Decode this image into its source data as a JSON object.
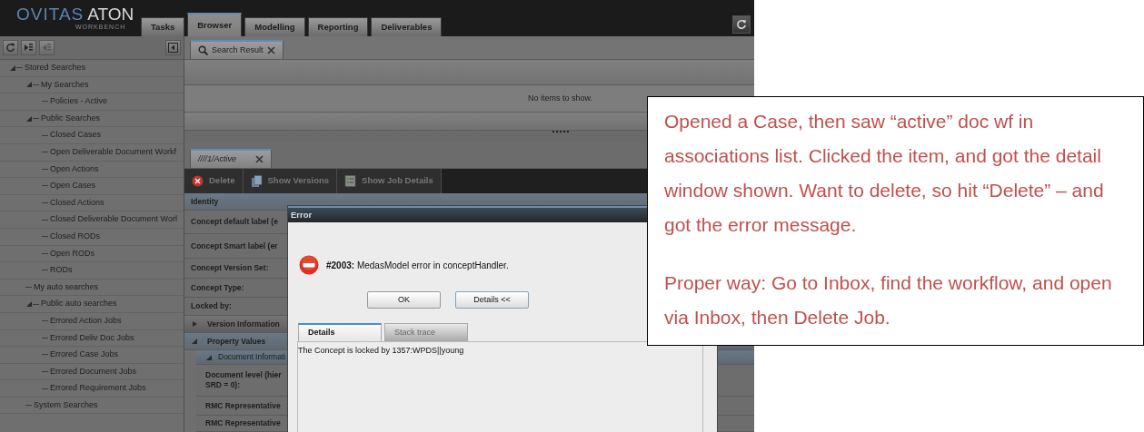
{
  "logo": {
    "brand": "OVITAS",
    "product": "ATON",
    "subtitle": "WORKBENCH"
  },
  "main_tabs": [
    {
      "label": "Tasks",
      "selected": false
    },
    {
      "label": "Browser",
      "selected": true
    },
    {
      "label": "Modelling",
      "selected": false
    },
    {
      "label": "Reporting",
      "selected": false
    },
    {
      "label": "Deliverables",
      "selected": false
    }
  ],
  "tree": [
    {
      "label": "Stored Searches",
      "expanded": true,
      "children": [
        {
          "label": "My Searches",
          "expanded": true,
          "children": [
            {
              "label": "Policies - Active"
            }
          ]
        },
        {
          "label": "Public Searches",
          "expanded": true,
          "children": [
            {
              "label": "Closed Cases"
            },
            {
              "label": "Open Deliverable Document Workf"
            },
            {
              "label": "Open Actions"
            },
            {
              "label": "Open Cases"
            },
            {
              "label": "Closed Actions"
            },
            {
              "label": "Closed Deliverable Document Worl"
            },
            {
              "label": "Closed RODs"
            },
            {
              "label": "Open RODs"
            },
            {
              "label": "RODs"
            }
          ]
        },
        {
          "label": "My auto searches"
        },
        {
          "label": "Public auto searches",
          "expanded": true,
          "children": [
            {
              "label": "Errored Action Jobs"
            },
            {
              "label": "Errored Deliv Doc Jobs"
            },
            {
              "label": "Errored Case Jobs"
            },
            {
              "label": "Errored Document Jobs"
            },
            {
              "label": "Errored Requirement Jobs"
            }
          ]
        },
        {
          "label": "System Searches"
        }
      ]
    }
  ],
  "search_tab": {
    "label": "Search Result"
  },
  "empty_message": "No items to show.",
  "detail_tab": {
    "label": "////1/Active"
  },
  "toolbar": [
    {
      "kind": "delete",
      "label": "Delete"
    },
    {
      "kind": "versions",
      "label": "Show Versions"
    },
    {
      "kind": "job",
      "label": "Show Job Details"
    }
  ],
  "properties": [
    {
      "kind": "header",
      "label": "Identity"
    },
    {
      "kind": "field",
      "label": "Concept default label (e"
    },
    {
      "kind": "field",
      "label": "Concept Smart label (er"
    },
    {
      "kind": "field",
      "label": "Concept Version Set:"
    },
    {
      "kind": "field",
      "label": "Concept Type:"
    },
    {
      "kind": "field",
      "label": "Locked by:"
    },
    {
      "kind": "group",
      "label": "Version Information",
      "expanded": false
    },
    {
      "kind": "group",
      "label": "Property Values",
      "expanded": true
    },
    {
      "kind": "subgroup",
      "label": "Document Informati",
      "expanded": true
    },
    {
      "kind": "subfield",
      "label": "Document level (hier\nSRD = 0):"
    },
    {
      "kind": "subfield",
      "label": "RMC Representative"
    },
    {
      "kind": "subfield",
      "label": "RMC Representative"
    }
  ],
  "dialog": {
    "title": "Error",
    "message": "**#2003:** MedasModel error in conceptHandler.",
    "buttons": [
      "OK",
      "Details <<"
    ],
    "tabs": [
      {
        "label": "Details",
        "selected": true
      },
      {
        "label": "Stack trace",
        "selected": false
      }
    ],
    "detail_text": "The Concept is locked by 1357:WPDS||young"
  },
  "callout": {
    "paragraphs": [
      "Opened a Case, then saw “active” doc wf in associations list.  Clicked the item, and got the detail window shown.  Want to delete, so hit “Delete” – and got the error message.",
      "Proper way: Go to Inbox, find the workflow, and open via Inbox, then Delete Job."
    ]
  }
}
